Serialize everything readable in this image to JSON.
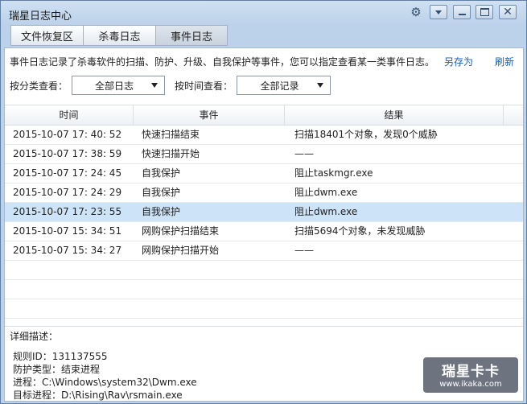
{
  "window": {
    "title": "瑞星日志中心"
  },
  "tabs": [
    {
      "label": "文件恢复区"
    },
    {
      "label": "杀毒日志"
    },
    {
      "label": "事件日志"
    }
  ],
  "desc": "事件日志记录了杀毒软件的扫描、防护、升级、自我保护等事件，您可以指定查看某一类事件日志。",
  "links": {
    "save_as": "另存为",
    "refresh": "刷新"
  },
  "filters": {
    "category_label": "按分类查看：",
    "category_value": "全部日志",
    "time_label": "按时间查看：",
    "time_value": "全部记录"
  },
  "table": {
    "columns": [
      "时间",
      "事件",
      "结果"
    ],
    "rows": [
      [
        "2015-10-07 17: 40: 52",
        "快速扫描结束",
        "扫描18401个对象，发现0个威胁"
      ],
      [
        "2015-10-07 17: 38: 59",
        "快速扫描开始",
        "——"
      ],
      [
        "2015-10-07 17: 24: 45",
        "自我保护",
        "阻止taskmgr.exe"
      ],
      [
        "2015-10-07 17: 24: 29",
        "自我保护",
        "阻止dwm.exe"
      ],
      [
        "2015-10-07 17: 23: 55",
        "自我保护",
        "阻止dwm.exe"
      ],
      [
        "2015-10-07 15: 34: 51",
        "网购保护扫描结束",
        "扫描5694个对象，未发现威胁"
      ],
      [
        "2015-10-07 15: 34: 27",
        "网购保护扫描开始",
        "——"
      ]
    ],
    "selected_index": 4
  },
  "detail": {
    "heading": "详细描述：",
    "lines": [
      "规则ID：131137555",
      "防护类型：结束进程",
      "进程：C:\\Windows\\system32\\Dwm.exe",
      "目标进程：D:\\Rising\\Rav\\rsmain.exe"
    ]
  },
  "watermark": {
    "title": "瑞星卡卡",
    "url": "www.ikaka.com"
  }
}
